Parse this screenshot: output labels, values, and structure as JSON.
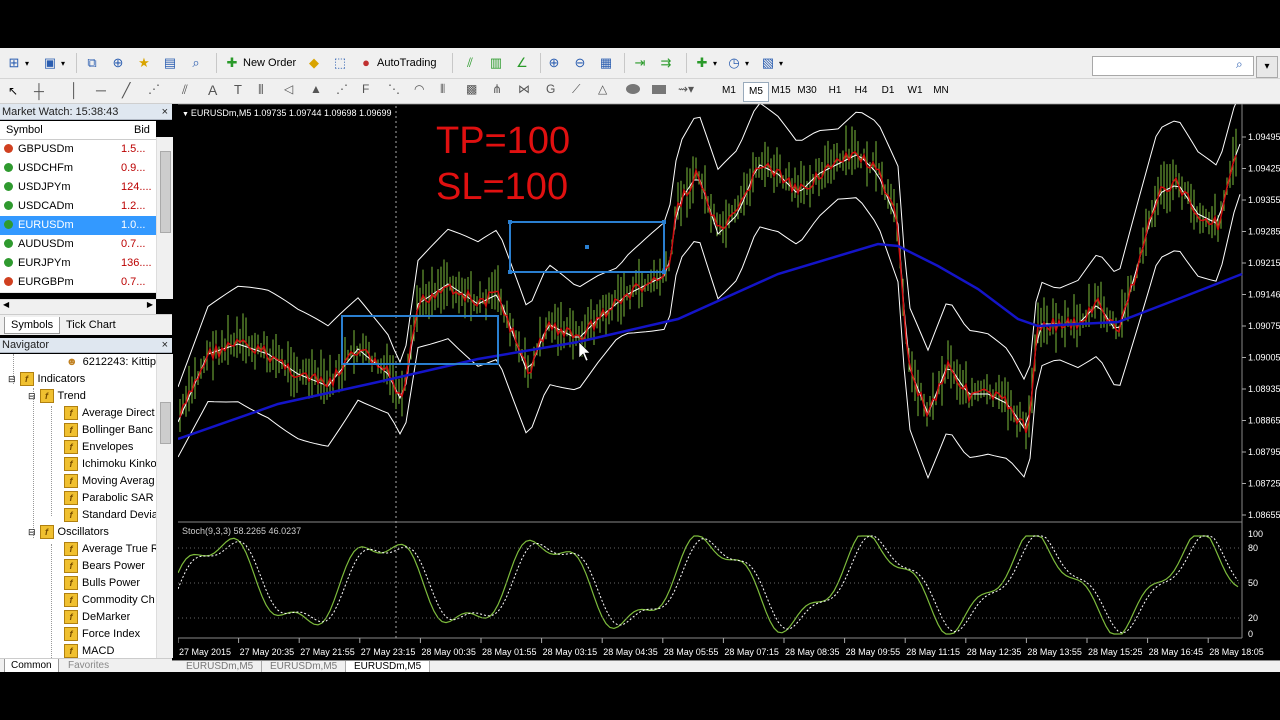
{
  "toolbar": {
    "new_order_label": "New Order",
    "autotrading_label": "AutoTrading",
    "timeframes": [
      "M1",
      "M5",
      "M15",
      "M30",
      "H1",
      "H4",
      "D1",
      "W1",
      "MN"
    ],
    "active_timeframe": "M5"
  },
  "market_watch": {
    "title": "Market Watch: 15:38:43",
    "col_symbol": "Symbol",
    "col_bid": "Bid",
    "rows": [
      {
        "symbol": "GBPUSDm",
        "bid": "1.5...",
        "dir": "down"
      },
      {
        "symbol": "USDCHFm",
        "bid": "0.9...",
        "dir": "up"
      },
      {
        "symbol": "USDJPYm",
        "bid": "124....",
        "dir": "up"
      },
      {
        "symbol": "USDCADm",
        "bid": "1.2...",
        "dir": "up"
      },
      {
        "symbol": "EURUSDm",
        "bid": "1.0...",
        "dir": "up"
      },
      {
        "symbol": "AUDUSDm",
        "bid": "0.7...",
        "dir": "up"
      },
      {
        "symbol": "EURJPYm",
        "bid": "136....",
        "dir": "up"
      },
      {
        "symbol": "EURGBPm",
        "bid": "0.7...",
        "dir": "down"
      }
    ],
    "selected_index": 4,
    "tabs": [
      "Symbols",
      "Tick Chart"
    ]
  },
  "navigator": {
    "title": "Navigator",
    "account": "6212243: Kittip",
    "indicators_label": "Indicators",
    "trend_label": "Trend",
    "trend_items": [
      "Average Direct",
      "Bollinger Banc",
      "Envelopes",
      "Ichimoku Kinko",
      "Moving Averag",
      "Parabolic SAR",
      "Standard Devia"
    ],
    "oscillators_label": "Oscillators",
    "oscillator_items": [
      "Average True R",
      "Bears Power",
      "Bulls Power",
      "Commodity Ch",
      "DeMarker",
      "Force Index",
      "MACD"
    ],
    "tabs": [
      "Common",
      "Favorites"
    ]
  },
  "chart": {
    "header": "EURUSDm,M5  1.09735 1.09744 1.09698 1.09699",
    "annotation_tp": "TP=100",
    "annotation_sl": "SL=100",
    "indicator_label": "Stoch(9,3,3) 58.2265 46.0237",
    "price_ticks": [
      "1.09495",
      "1.09425",
      "1.09355",
      "1.09285",
      "1.09215",
      "1.09146",
      "1.09075",
      "1.09005",
      "1.08935",
      "1.08865",
      "1.08795",
      "1.08725",
      "1.08655"
    ],
    "stoch_ticks": [
      "100",
      "80",
      "50",
      "20",
      "0"
    ],
    "time_labels": [
      "27 May 2015",
      "27 May 20:35",
      "27 May 21:55",
      "27 May 23:15",
      "28 May 00:35",
      "28 May 01:55",
      "28 May 03:15",
      "28 May 04:35",
      "28 May 05:55",
      "28 May 07:15",
      "28 May 08:35",
      "28 May 09:55",
      "28 May 11:15",
      "28 May 12:35",
      "28 May 13:55",
      "28 May 15:25",
      "28 May 16:45",
      "28 May 18:05"
    ],
    "colors": {
      "price_text": "#ffffff",
      "annotation": "#e01010",
      "ma": "#1010c8",
      "bands": "#ffffff",
      "candles": "#7dbb3c",
      "close_line": "#d01010",
      "rect": "#2a7fd0"
    }
  },
  "chart_data": {
    "type": "line",
    "series": [],
    "ylim": [
      1.08655,
      1.09495
    ],
    "grid": false
  },
  "bottom_tabs": [
    "EURUSDm,M5",
    "EURUSDm,M5",
    "EURUSDm,M5"
  ],
  "active_bottom_tab": 2
}
